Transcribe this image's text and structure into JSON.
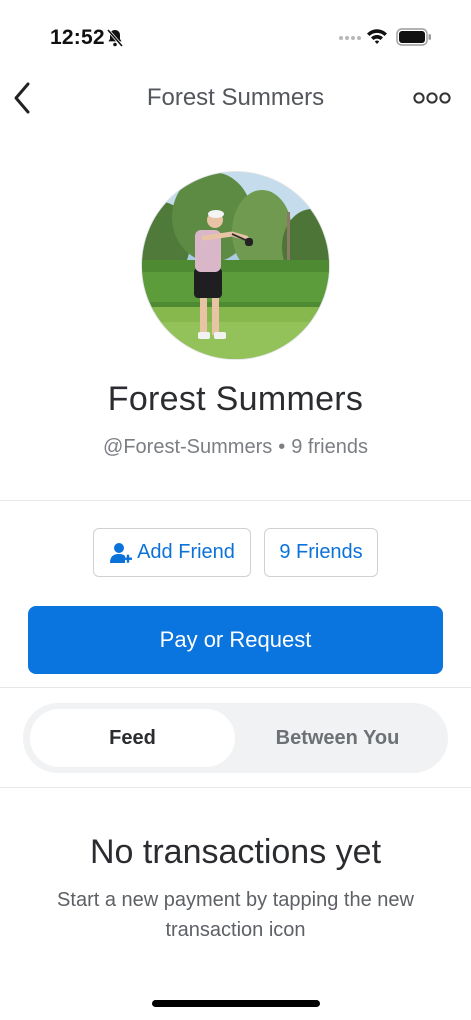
{
  "status_bar": {
    "time": "12:52",
    "icons": [
      "bell-slash-icon",
      "signal-icon",
      "wifi-icon",
      "battery-icon"
    ]
  },
  "nav": {
    "title": "Forest Summers",
    "back_icon": "chevron-left-icon",
    "more_icon": "more-horizontal-icon"
  },
  "profile": {
    "name": "Forest Summers",
    "username": "@Forest-Summers",
    "separator": "•",
    "friends_count": "9 friends",
    "avatar": "golfer-photo"
  },
  "actions": {
    "add_friend_label": "Add Friend",
    "friends_label": "9 Friends",
    "pay_label": "Pay or Request"
  },
  "tabs": [
    {
      "label": "Feed",
      "selected": true
    },
    {
      "label": "Between You",
      "selected": false
    }
  ],
  "empty_state": {
    "title": "No transactions yet",
    "subtitle": "Start a new payment by tapping the new transaction icon"
  },
  "colors": {
    "accent": "#0a74df",
    "link": "#0b72d9",
    "segment_bg": "#f1f2f3",
    "divider": "#e6e7e9"
  }
}
